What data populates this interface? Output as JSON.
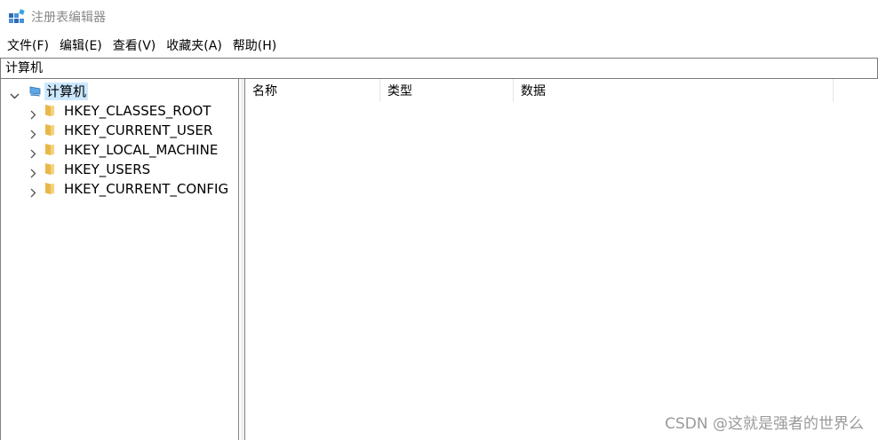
{
  "window": {
    "title": "注册表编辑器",
    "address": "计算机"
  },
  "menu": [
    "文件(F)",
    "编辑(E)",
    "查看(V)",
    "收藏夹(A)",
    "帮助(H)"
  ],
  "tree": {
    "root": "计算机",
    "root_expanded": true,
    "children": [
      "HKEY_CLASSES_ROOT",
      "HKEY_CURRENT_USER",
      "HKEY_LOCAL_MACHINE",
      "HKEY_USERS",
      "HKEY_CURRENT_CONFIG"
    ]
  },
  "list": {
    "columns": [
      "名称",
      "类型",
      "数据"
    ],
    "rows": []
  },
  "watermark": "CSDN @这就是强者的世界么",
  "icons": {
    "app": "registry-editor-icon",
    "computer": "computer-icon",
    "folder": "folder-icon",
    "expand": "chevron-down-icon",
    "collapse": "chevron-right-icon"
  },
  "colors": {
    "selection": "#cce8ff",
    "folder": "#e8b84a",
    "border": "#828282"
  }
}
